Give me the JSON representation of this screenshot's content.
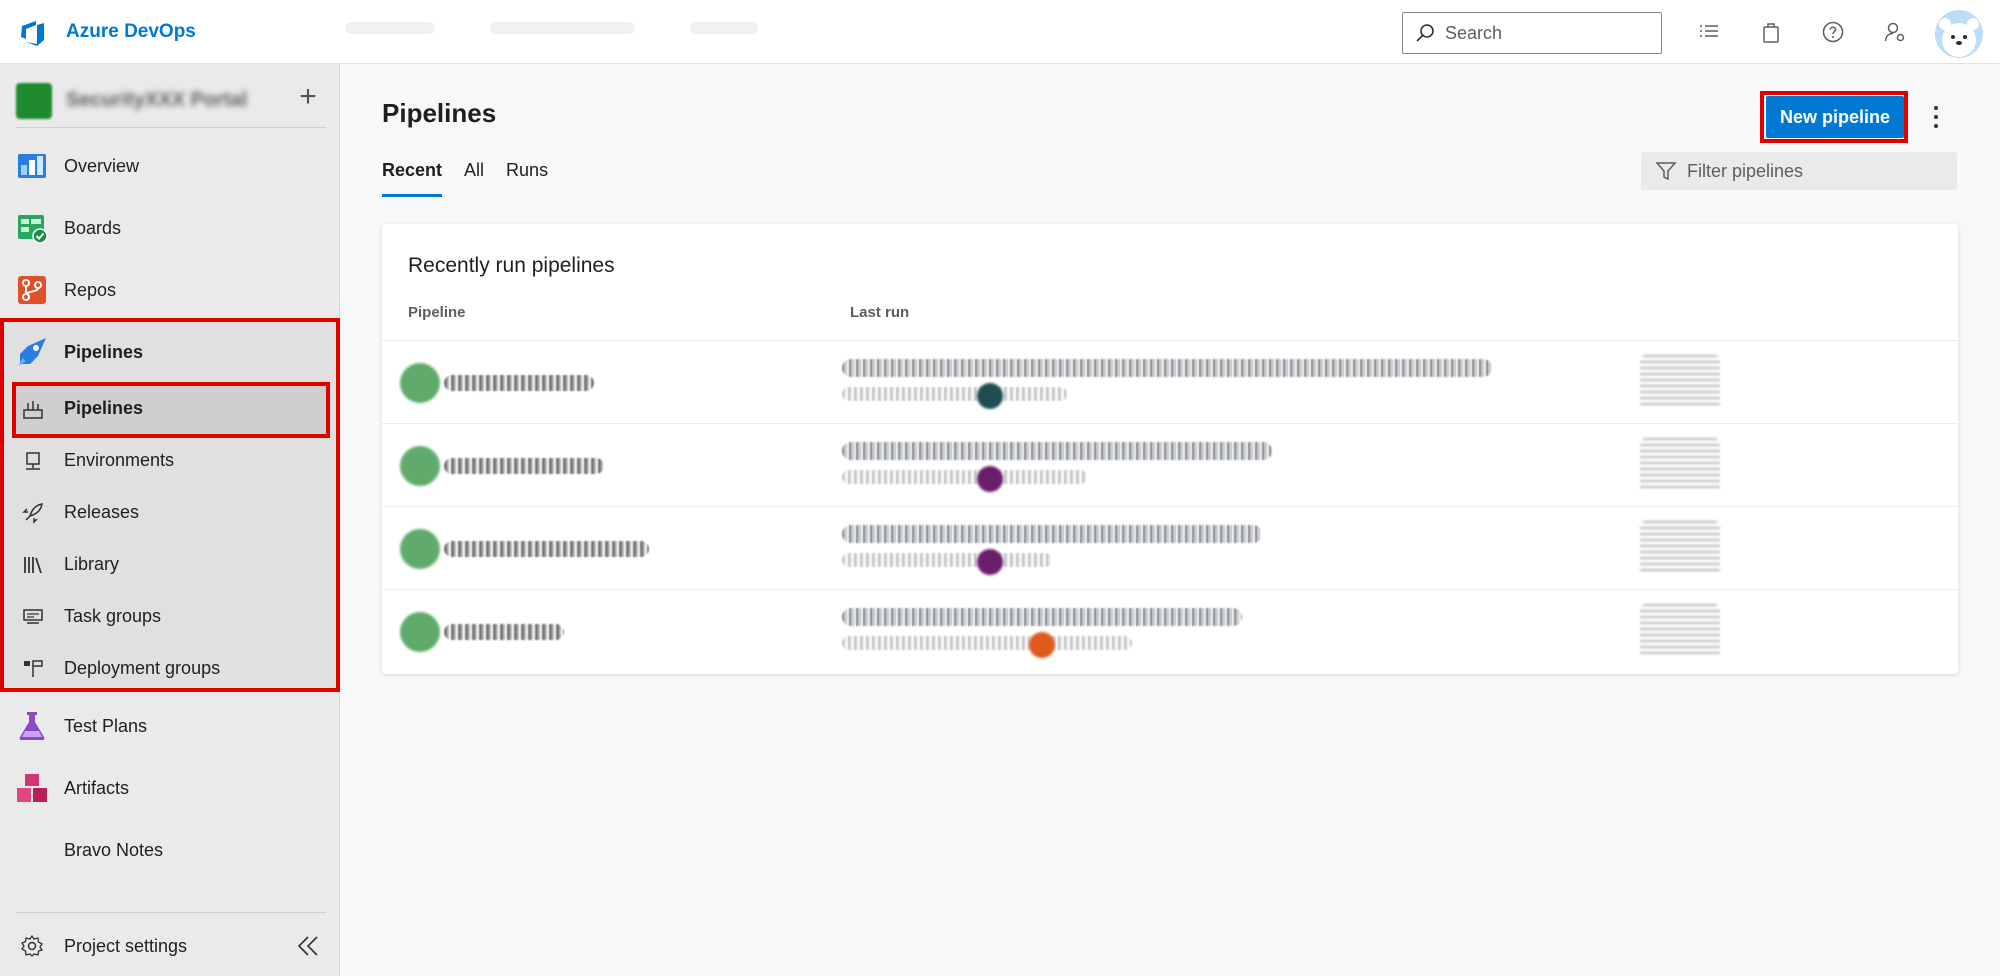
{
  "app": {
    "brand": "Azure DevOps"
  },
  "header": {
    "search_placeholder": "Search"
  },
  "sidebar": {
    "add_label": "+",
    "items": [
      {
        "label": "Overview",
        "icon": "overview-icon"
      },
      {
        "label": "Boards",
        "icon": "boards-icon"
      },
      {
        "label": "Repos",
        "icon": "repos-icon"
      },
      {
        "label": "Pipelines",
        "icon": "pipelines-icon"
      },
      {
        "label": "Test Plans",
        "icon": "test-plans-icon"
      },
      {
        "label": "Artifacts",
        "icon": "artifacts-icon"
      },
      {
        "label": "Bravo Notes",
        "icon": ""
      }
    ],
    "pipelines_sub": [
      {
        "label": "Pipelines",
        "icon": "pipelines-sub-icon"
      },
      {
        "label": "Environments",
        "icon": "environments-icon"
      },
      {
        "label": "Releases",
        "icon": "releases-icon"
      },
      {
        "label": "Library",
        "icon": "library-icon"
      },
      {
        "label": "Task groups",
        "icon": "task-groups-icon"
      },
      {
        "label": "Deployment groups",
        "icon": "deployment-groups-icon"
      }
    ],
    "project_settings": "Project settings"
  },
  "main": {
    "title": "Pipelines",
    "new_button": "New pipeline",
    "tabs": [
      "Recent",
      "All",
      "Runs"
    ],
    "active_tab": "Recent",
    "filter_placeholder": "Filter pipelines",
    "card": {
      "title": "Recently run pipelines",
      "columns": [
        "Pipeline",
        "Last run"
      ]
    },
    "rows": [
      {
        "status_color": "#4fa35b",
        "avatar_color": "#1e4e52"
      },
      {
        "status_color": "#4fa35b",
        "avatar_color": "#6b1d6b"
      },
      {
        "status_color": "#4fa35b",
        "avatar_color": "#6b1d6b"
      },
      {
        "status_color": "#4fa35b",
        "avatar_color": "#e05a1b"
      }
    ]
  },
  "colors": {
    "accent": "#0078d4",
    "highlight_box": "#e00000"
  }
}
